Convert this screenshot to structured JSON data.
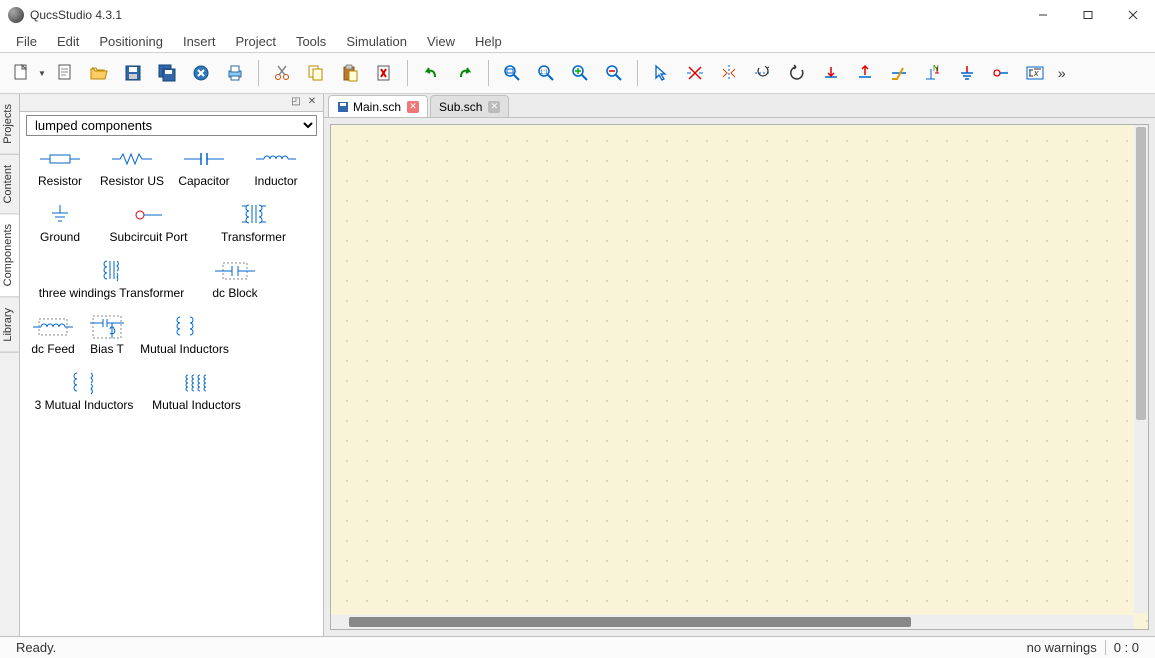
{
  "app": {
    "title": "QucsStudio 4.3.1"
  },
  "menu": {
    "file": "File",
    "edit": "Edit",
    "positioning": "Positioning",
    "insert": "Insert",
    "project": "Project",
    "tools": "Tools",
    "simulation": "Simulation",
    "view": "View",
    "help": "Help"
  },
  "sidebar_tabs": {
    "projects": "Projects",
    "content": "Content",
    "components": "Components",
    "library": "Library"
  },
  "panel": {
    "category": "lumped components"
  },
  "components": {
    "r": "Resistor",
    "rus": "Resistor US",
    "c": "Capacitor",
    "l": "Inductor",
    "gnd": "Ground",
    "subp": "Subcircuit Port",
    "tr": "Transformer",
    "tw": "three windings Transformer",
    "dcb": "dc Block",
    "dcf": "dc Feed",
    "bias": "Bias T",
    "mi": "Mutual Inductors",
    "mi3": "3 Mutual Inductors",
    "min": "Mutual Inductors"
  },
  "tabs": {
    "main": "Main.sch",
    "sub": "Sub.sch"
  },
  "status": {
    "ready": "Ready.",
    "warnings": "no warnings",
    "pos": "0 : 0"
  }
}
